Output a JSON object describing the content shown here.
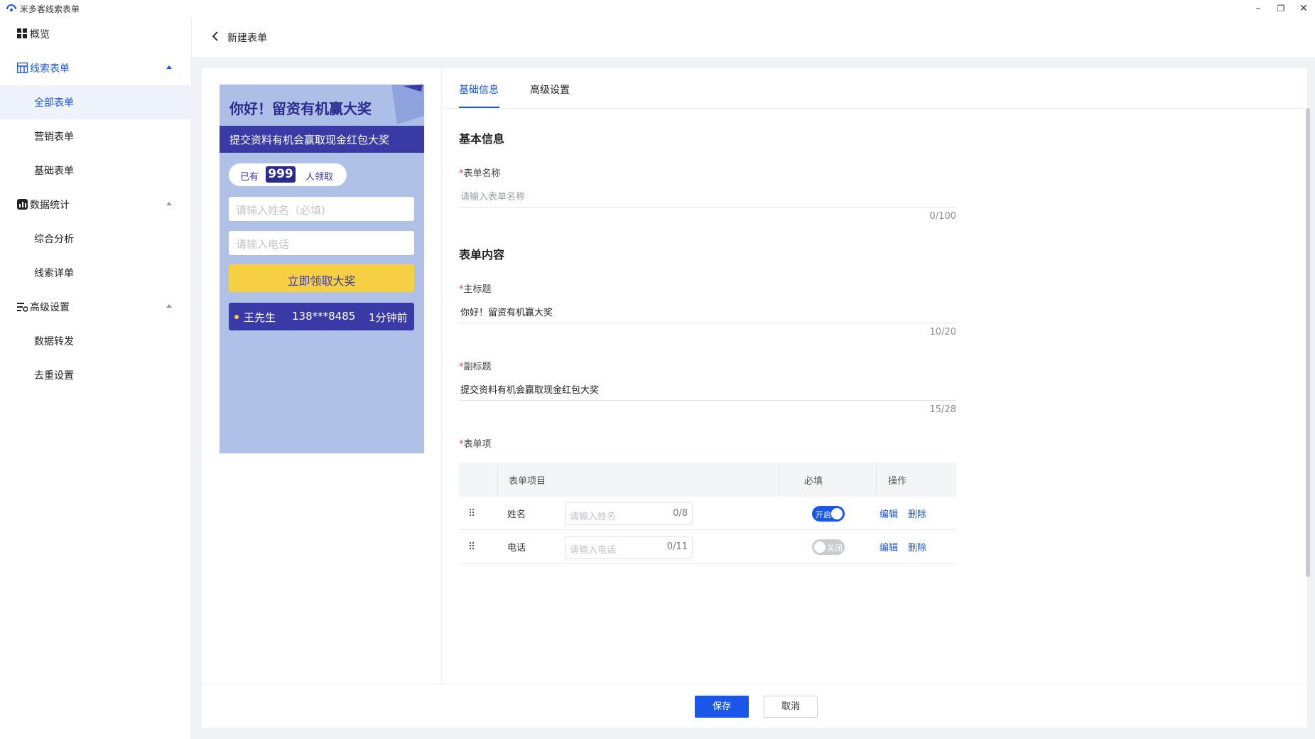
{
  "app": {
    "title": "米多客线索表单"
  },
  "window": {
    "minimize": "–",
    "restore": "❐",
    "close": "✕"
  },
  "sidebar": {
    "overview": "概览",
    "groups": [
      {
        "label": "线索表单",
        "items": [
          "全部表单",
          "营销表单",
          "基础表单"
        ]
      },
      {
        "label": "数据统计",
        "items": [
          "综合分析",
          "线索详单"
        ]
      },
      {
        "label": "高级设置",
        "items": [
          "数据转发",
          "去重设置"
        ]
      }
    ]
  },
  "breadcrumb": {
    "title": "新建表单"
  },
  "preview": {
    "title": "你好！留资有机赢大奖",
    "subtitle": "提交资料有机会赢取现金红包大奖",
    "counter_prefix": "已有",
    "counter_value": "999",
    "counter_suffix": "人领取",
    "name_placeholder": "请输入姓名（必填)",
    "phone_placeholder": "请输入电话",
    "button": "立即领取大奖",
    "ticker": {
      "name": "王先生",
      "phone": "138***8485",
      "time": "1分钟前"
    }
  },
  "tabs": [
    "基础信息",
    "高级设置"
  ],
  "form": {
    "section_basic": "基本信息",
    "form_name": {
      "label": "表单名称",
      "placeholder": "请输入表单名称",
      "counter": "0/100"
    },
    "section_content": "表单内容",
    "main_title": {
      "label": "主标题",
      "value": "你好！留资有机赢大奖",
      "counter": "10/20"
    },
    "sub_title": {
      "label": "副标题",
      "value": "提交资料有机会赢取现金红包大奖",
      "counter": "15/28"
    },
    "items_label": "表单项",
    "required_mark": "*",
    "table": {
      "headers": [
        "表单项目",
        "必填",
        "操作"
      ],
      "rows": [
        {
          "name": "姓名",
          "placeholder": "请输入姓名",
          "count": "0/8",
          "required": "开启",
          "on": true,
          "edit": "编辑",
          "delete": "删除"
        },
        {
          "name": "电话",
          "placeholder": "请输入电话",
          "count": "0/11",
          "required": "关闭",
          "on": false,
          "edit": "编辑",
          "delete": "删除"
        }
      ]
    }
  },
  "footer": {
    "save": "保存",
    "cancel": "取消"
  },
  "colors": {
    "primary": "#1a56e8",
    "preview_bg": "#b0c1e8",
    "preview_dark": "#3a3aa6",
    "cta": "#f6cf45"
  }
}
